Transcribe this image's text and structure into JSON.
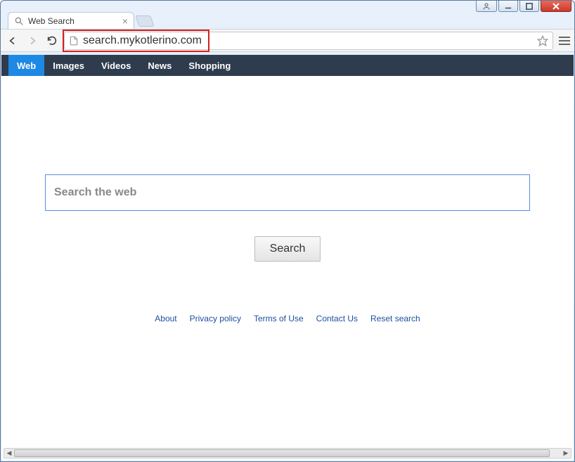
{
  "tab": {
    "title": "Web Search"
  },
  "address": {
    "url": "search.mykotlerino.com"
  },
  "nav": {
    "items": [
      "Web",
      "Images",
      "Videos",
      "News",
      "Shopping"
    ],
    "active_index": 0
  },
  "search": {
    "placeholder": "Search the web",
    "button_label": "Search",
    "value": ""
  },
  "footer": {
    "links": [
      "About",
      "Privacy policy",
      "Terms of Use",
      "Contact Us",
      "Reset search"
    ]
  }
}
